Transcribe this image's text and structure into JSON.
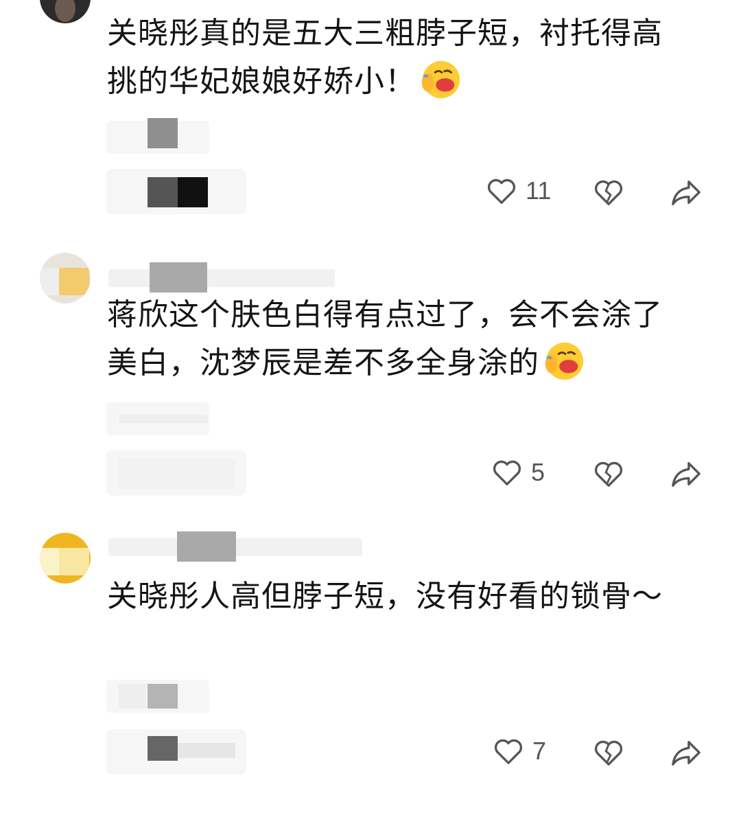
{
  "comments": [
    {
      "text": "关晓彤真的是五大三粗脖子短，衬托得高挑的华妃娘娘好娇小！",
      "emoji": "face-with-tears-of-joy-covering-icon",
      "likes": "11"
    },
    {
      "text": "蒋欣这个肤色白得有点过了，会不会涂了美白，沈梦辰是差不多全身涂的",
      "emoji": "face-with-tears-of-joy-covering-icon",
      "likes": "5"
    },
    {
      "text": "关晓彤人高但脖子短，没有好看的锁骨～",
      "likes": "7"
    }
  ],
  "colors": {
    "text": "#141414",
    "pill": "#f6f6f6",
    "icon": "#555555",
    "redaction_dark": "#111111",
    "redaction_mid": "#555555",
    "redaction_light": "#a9a9a9"
  }
}
